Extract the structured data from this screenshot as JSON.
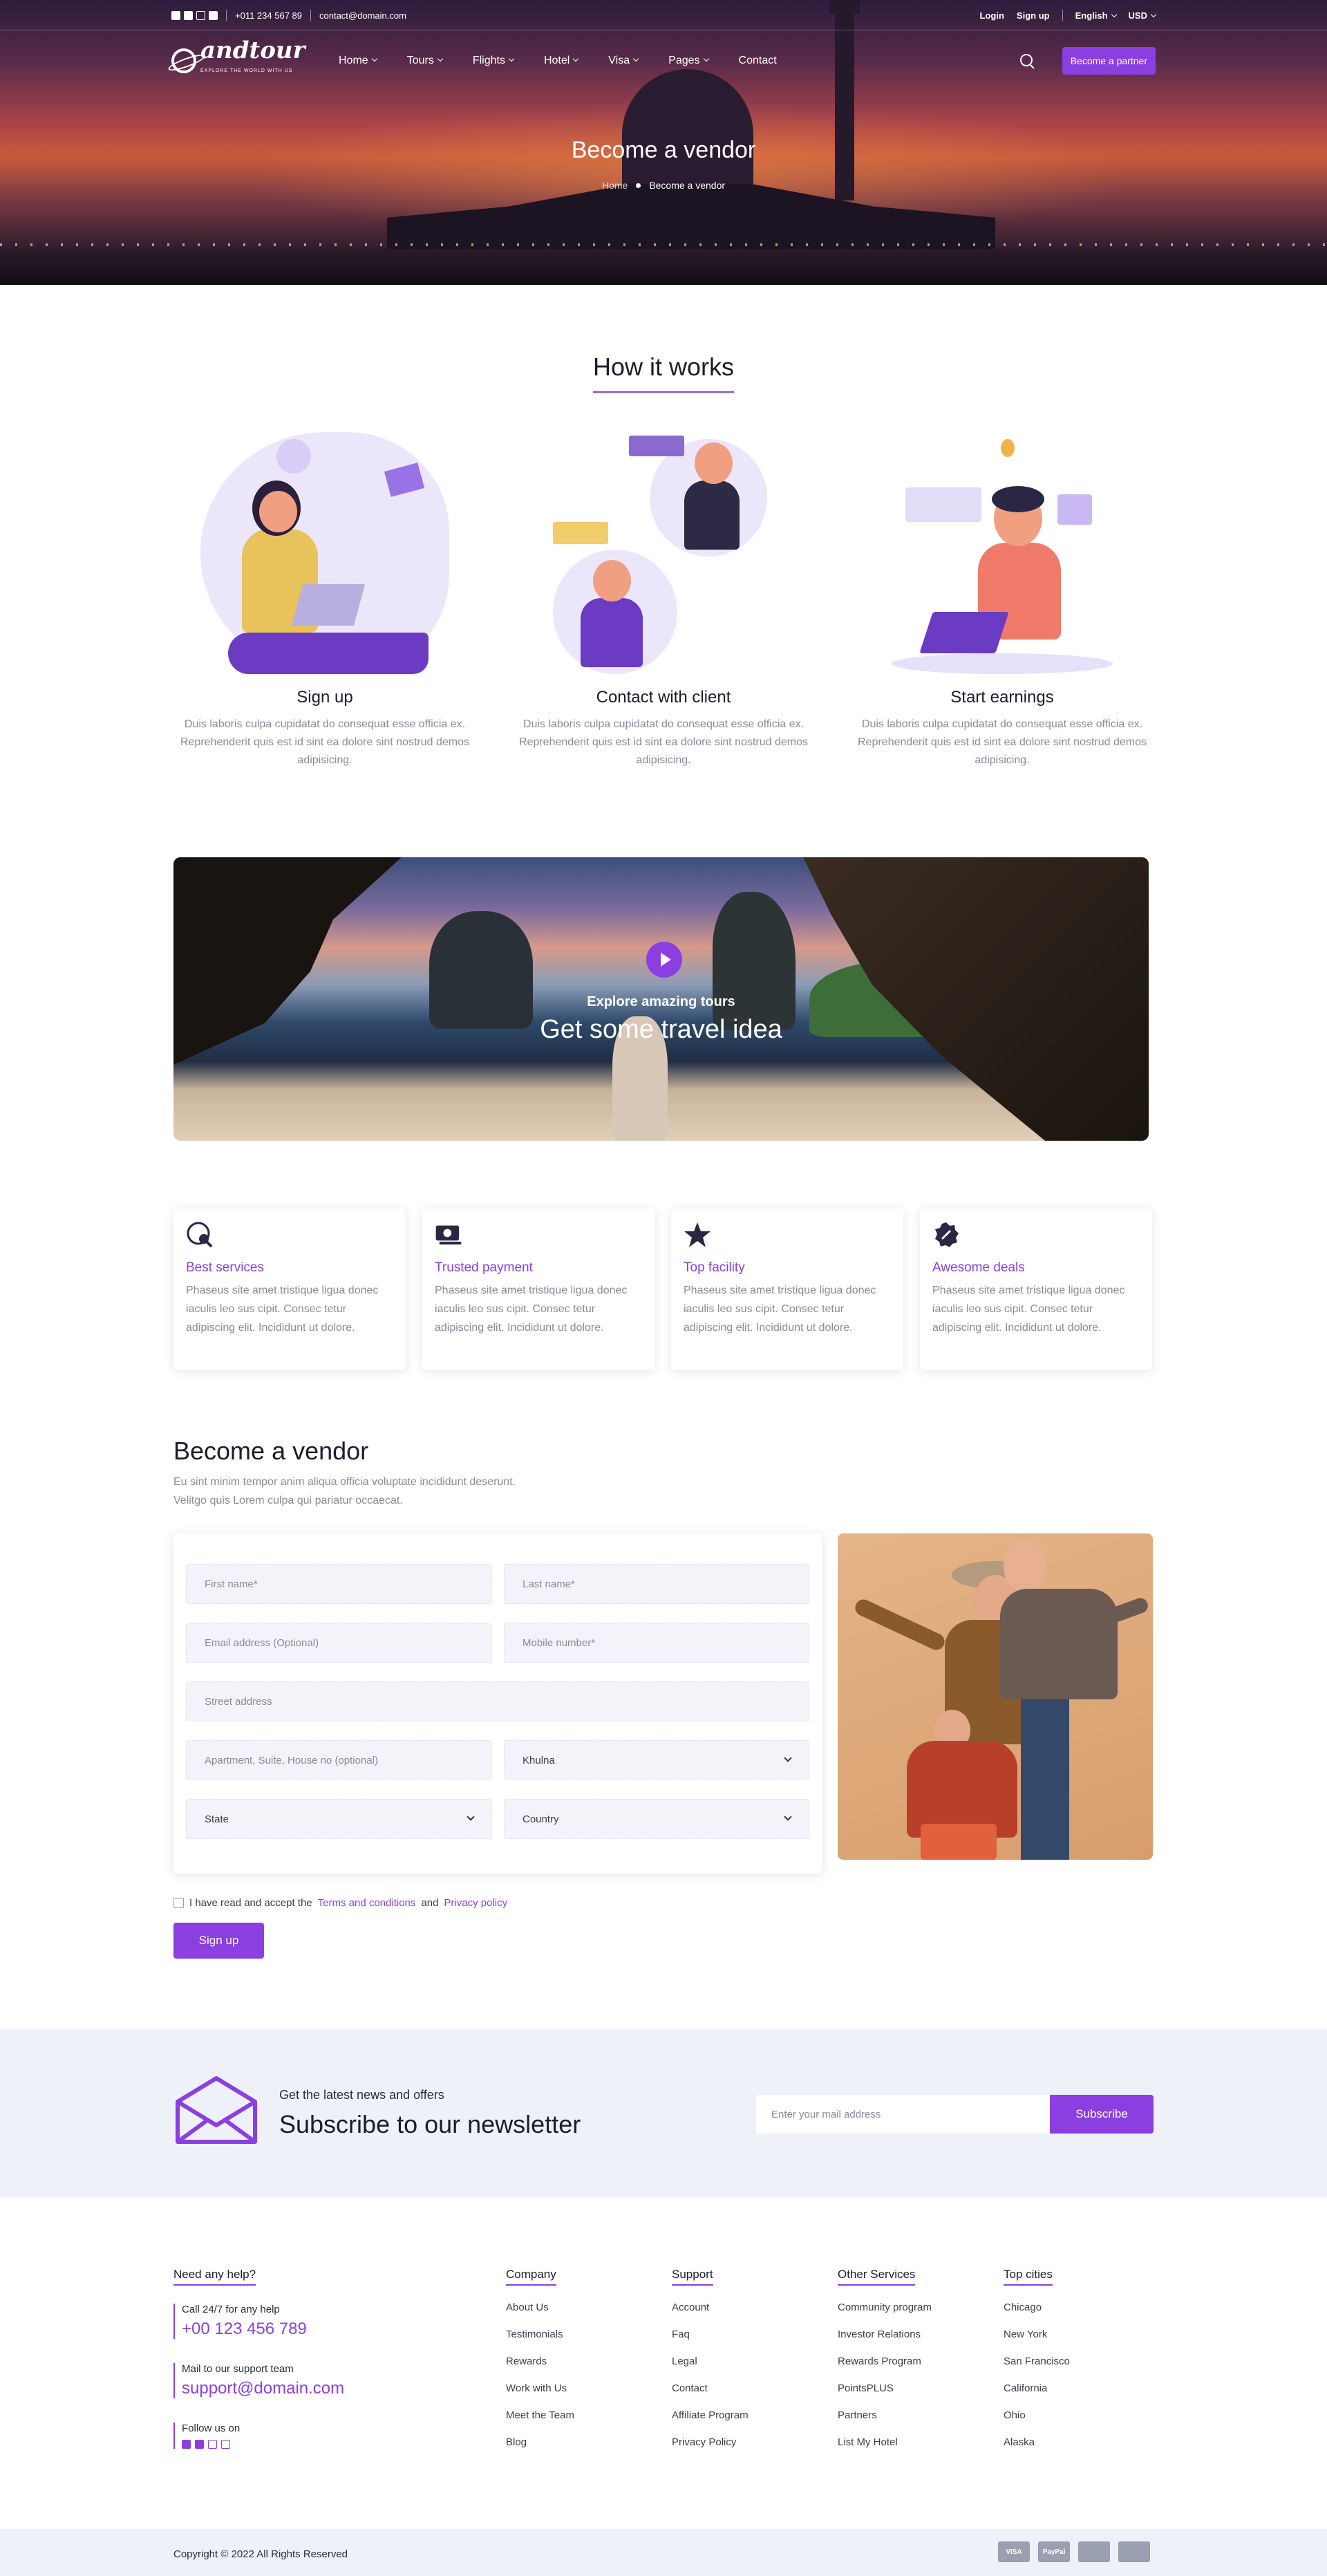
{
  "topbar": {
    "phone": "+011 234 567 89",
    "email": "contact@domain.com",
    "login": "Login",
    "signup": "Sign up",
    "language": "English",
    "currency": "USD"
  },
  "brand": {
    "name": "andtour",
    "tagline": "EXPLORE THE WORLD WITH US"
  },
  "nav": {
    "items": [
      "Home",
      "Tours",
      "Flights",
      "Hotel",
      "Visa",
      "Pages"
    ],
    "contact": "Contact",
    "partner_button": "Become a partner"
  },
  "hero": {
    "title": "Become a vendor",
    "breadcrumb_home": "Home",
    "breadcrumb_current": "Become a vendor"
  },
  "how_it_works": {
    "title": "How it works",
    "steps": [
      {
        "title": "Sign up",
        "desc": "Duis laboris culpa cupidatat do consequat esse officia ex. Reprehenderit quis est id sint ea dolore sint nostrud demos adipisicing."
      },
      {
        "title": "Contact with client",
        "desc": "Duis laboris culpa cupidatat do consequat esse officia ex. Reprehenderit quis est id sint ea dolore sint nostrud demos adipisicing."
      },
      {
        "title": "Start earnings",
        "desc": "Duis laboris culpa cupidatat do consequat esse officia ex. Reprehenderit quis est id sint ea dolore sint nostrud demos adipisicing."
      }
    ]
  },
  "video": {
    "small": "Explore amazing tours",
    "big": "Get some travel idea"
  },
  "features": [
    {
      "icon": "globe-search-icon",
      "title": "Best services",
      "desc": "Phaseus site amet tristique ligua donec iaculis leo sus cipit. Consec tetur adipiscing elit. Incididunt ut dolore."
    },
    {
      "icon": "cash-icon",
      "title": "Trusted payment",
      "desc": "Phaseus site amet tristique ligua donec iaculis leo sus cipit. Consec tetur adipiscing elit. Incididunt ut dolore."
    },
    {
      "icon": "star-icon",
      "title": "Top facility",
      "desc": "Phaseus site amet tristique ligua donec iaculis leo sus cipit. Consec tetur adipiscing elit. Incididunt ut dolore."
    },
    {
      "icon": "discount-badge-icon",
      "title": "Awesome deals",
      "desc": "Phaseus site amet tristique ligua donec iaculis leo sus cipit. Consec tetur adipiscing elit. Incididunt ut dolore."
    }
  ],
  "vendor": {
    "title": "Become a vendor",
    "subtitle_1": "Eu sint minim tempor anim aliqua officia voluptate incididunt deserunt.",
    "subtitle_2": "Velitgo quis Lorem culpa qui pariatur occaecat.",
    "form": {
      "first_name": "First name*",
      "last_name": "Last name*",
      "email": "Email address (Optional)",
      "mobile": "Mobile number*",
      "street": "Street address",
      "apartment": "Apartment, Suite, House no (optional)",
      "city": "Khulna",
      "state": "State",
      "country": "Country"
    },
    "agree_text": "I have read and accept the",
    "terms": "Terms and conditions",
    "and": "and",
    "privacy": "Privacy policy",
    "signup_button": "Sign up"
  },
  "newsletter": {
    "small": "Get the latest news and offers",
    "big": "Subscribe to our newsletter",
    "placeholder": "Enter your mail address",
    "button": "Subscribe"
  },
  "footer": {
    "help_title": "Need any help?",
    "call_label": "Call 24/7 for any help",
    "phone": "+00 123 456 789",
    "mail_label": "Mail to our support team",
    "mail": "support@domain.com",
    "follow": "Follow us on",
    "columns": [
      {
        "title": "Company",
        "links": [
          "About Us",
          "Testimonials",
          "Rewards",
          "Work with Us",
          "Meet the Team",
          "Blog"
        ]
      },
      {
        "title": "Support",
        "links": [
          "Account",
          "Faq",
          "Legal",
          "Contact",
          "Affiliate Program",
          "Privacy Policy"
        ]
      },
      {
        "title": "Other Services",
        "links": [
          "Community program",
          "Investor Relations",
          "Rewards Program",
          "PointsPLUS",
          "Partners",
          "List My Hotel"
        ]
      },
      {
        "title": "Top cities",
        "links": [
          "Chicago",
          "New York",
          "San Francisco",
          "California",
          "Ohio",
          "Alaska"
        ]
      }
    ],
    "copyright": "Copyright © 2022 All Rights Reserved",
    "payments": [
      "VISA",
      "PayPal",
      "",
      ""
    ]
  },
  "colors": {
    "accent": "#8b3fe0",
    "text_muted": "#8a8a9a",
    "newsletter_bg": "#eff1f9"
  }
}
